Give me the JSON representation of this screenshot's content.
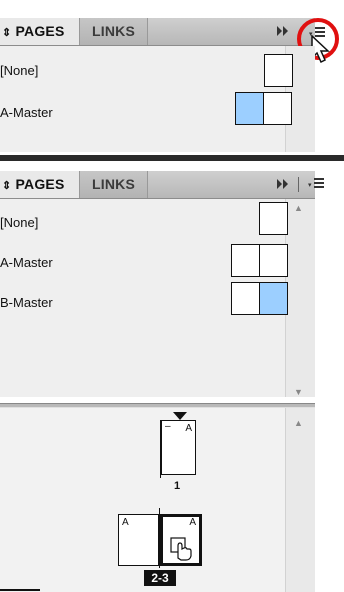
{
  "top_panel": {
    "tabs": [
      {
        "label": "PAGES",
        "collapse_glyph": "⇕"
      },
      {
        "label": "LINKS"
      }
    ],
    "expand_icon": "double-arrow-right-icon",
    "menu_icon": "panel-menu-icon",
    "menu_highlight_color": "#e01010",
    "masters": [
      {
        "label": "[None]"
      },
      {
        "label": "A-Master"
      }
    ]
  },
  "bottom_panel": {
    "tabs": [
      {
        "label": "PAGES",
        "collapse_glyph": "⇕"
      },
      {
        "label": "LINKS"
      }
    ],
    "expand_icon": "double-arrow-right-icon",
    "menu_icon": "panel-menu-icon",
    "masters": [
      {
        "label": "[None]"
      },
      {
        "label": "A-Master"
      },
      {
        "label": "B-Master"
      }
    ],
    "pages": [
      {
        "number": "1",
        "master_letter": "A",
        "guide_mark": "–"
      },
      {
        "number": "2-3",
        "left_master_letter": "A",
        "right_master_letter": "A"
      }
    ]
  },
  "colors": {
    "selected_page_fill": "#9ccfff",
    "tab_bar": "#c4c4c4",
    "panel_bg": "#efefef"
  }
}
